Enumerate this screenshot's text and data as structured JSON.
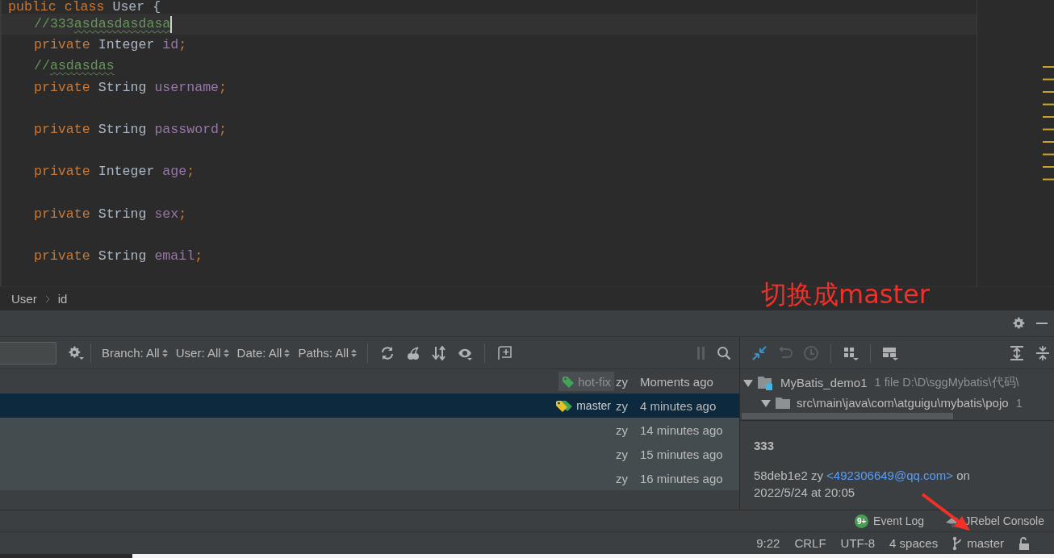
{
  "editor": {
    "class_line": [
      {
        "kind": "keyword",
        "text": "public class "
      },
      {
        "kind": "type",
        "text": "User {"
      }
    ],
    "members": [
      {
        "current": true,
        "blank_line_before": false,
        "tokens": [
          {
            "kind": "comment",
            "text": "//333"
          },
          {
            "kind": "typo",
            "text": "asdasdasdasa"
          }
        ]
      },
      {
        "current": false,
        "blank_line_before": false,
        "tokens": [
          {
            "kind": "keyword",
            "text": "private "
          },
          {
            "kind": "type",
            "text": "Integer "
          },
          {
            "kind": "field",
            "text": "id"
          },
          {
            "kind": "punct",
            "text": ";"
          }
        ]
      },
      {
        "current": false,
        "blank_line_before": false,
        "tokens": [
          {
            "kind": "comment",
            "text": "//"
          },
          {
            "kind": "typo",
            "text": "asdasdas"
          }
        ]
      },
      {
        "current": false,
        "blank_line_before": false,
        "tokens": [
          {
            "kind": "keyword",
            "text": "private "
          },
          {
            "kind": "type",
            "text": "String "
          },
          {
            "kind": "field",
            "text": "username"
          },
          {
            "kind": "punct",
            "text": ";"
          }
        ]
      },
      {
        "current": false,
        "blank_line_before": true,
        "tokens": [
          {
            "kind": "keyword",
            "text": "private "
          },
          {
            "kind": "type",
            "text": "String "
          },
          {
            "kind": "field",
            "text": "password"
          },
          {
            "kind": "punct",
            "text": ";"
          }
        ]
      },
      {
        "current": false,
        "blank_line_before": true,
        "tokens": [
          {
            "kind": "keyword",
            "text": "private "
          },
          {
            "kind": "type",
            "text": "Integer "
          },
          {
            "kind": "field",
            "text": "age"
          },
          {
            "kind": "punct",
            "text": ";"
          }
        ]
      },
      {
        "current": false,
        "blank_line_before": true,
        "tokens": [
          {
            "kind": "keyword",
            "text": "private "
          },
          {
            "kind": "type",
            "text": "String "
          },
          {
            "kind": "field",
            "text": "sex"
          },
          {
            "kind": "punct",
            "text": ";"
          }
        ]
      },
      {
        "current": false,
        "blank_line_before": true,
        "tokens": [
          {
            "kind": "keyword",
            "text": "private "
          },
          {
            "kind": "type",
            "text": "String "
          },
          {
            "kind": "field",
            "text": "email"
          },
          {
            "kind": "punct",
            "text": ";"
          }
        ]
      }
    ]
  },
  "breadcrumbs": [
    "User",
    "id"
  ],
  "annotation": {
    "text": "切换成master"
  },
  "log_toolbar": {
    "filters": [
      "Branch: All",
      "User: All",
      "Date: All",
      "Paths: All"
    ]
  },
  "log_rows": [
    {
      "refs": [
        {
          "name": "hot-fix",
          "kind": "tag"
        }
      ],
      "author": "zy",
      "date": "Moments ago",
      "selected": false,
      "highlighted": false
    },
    {
      "refs": [
        {
          "name": "master",
          "kind": "head"
        }
      ],
      "author": "zy",
      "date": "4 minutes ago",
      "selected": true,
      "highlighted": false
    },
    {
      "author": "zy",
      "date": "14 minutes ago",
      "selected": false,
      "highlighted": true
    },
    {
      "author": "zy",
      "date": "15 minutes ago",
      "selected": false,
      "highlighted": true
    },
    {
      "author": "zy",
      "date": "16 minutes ago",
      "selected": false,
      "highlighted": true
    }
  ],
  "changes_tree": [
    {
      "name": "MyBatis_demo1",
      "info": "1 file  D:\\D\\sggMybatis\\代码\\",
      "expanded": true,
      "kind": "module",
      "children": [
        {
          "name": "src\\main\\java\\com\\atguigu\\mybatis\\pojo",
          "info": "1",
          "expanded": true,
          "kind": "folder"
        }
      ]
    }
  ],
  "commit_details": {
    "message": "333",
    "hash": "58deb1e2",
    "author": "zy",
    "email": "<492306649@qq.com>",
    "on": "on",
    "date": "2022/5/24 at 20:05"
  },
  "tool_tabs": [
    {
      "badge": "9+",
      "label": "Event Log",
      "kind": "event-log"
    },
    {
      "label": "JRebel Console",
      "kind": "jrebel"
    }
  ],
  "status_bar": {
    "position": "9:22",
    "line_separator": "CRLF",
    "encoding": "UTF-8",
    "indent": "4 spaces",
    "branch": "master"
  }
}
